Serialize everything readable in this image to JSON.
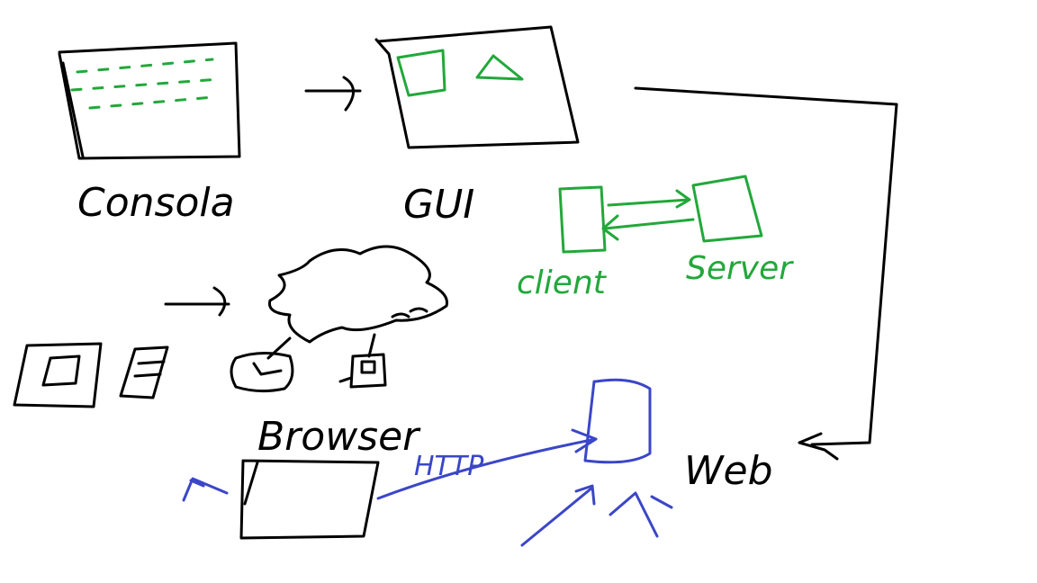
{
  "colors": {
    "ink_black": "#000000",
    "ink_green": "#22a83a",
    "ink_blue": "#3b46c8",
    "background": "#ffffff"
  },
  "labels": {
    "console": "Consola",
    "gui": "GUI",
    "client": "client",
    "server": "Server",
    "browser": "Browser",
    "http": "HTTP",
    "web": "Web"
  }
}
